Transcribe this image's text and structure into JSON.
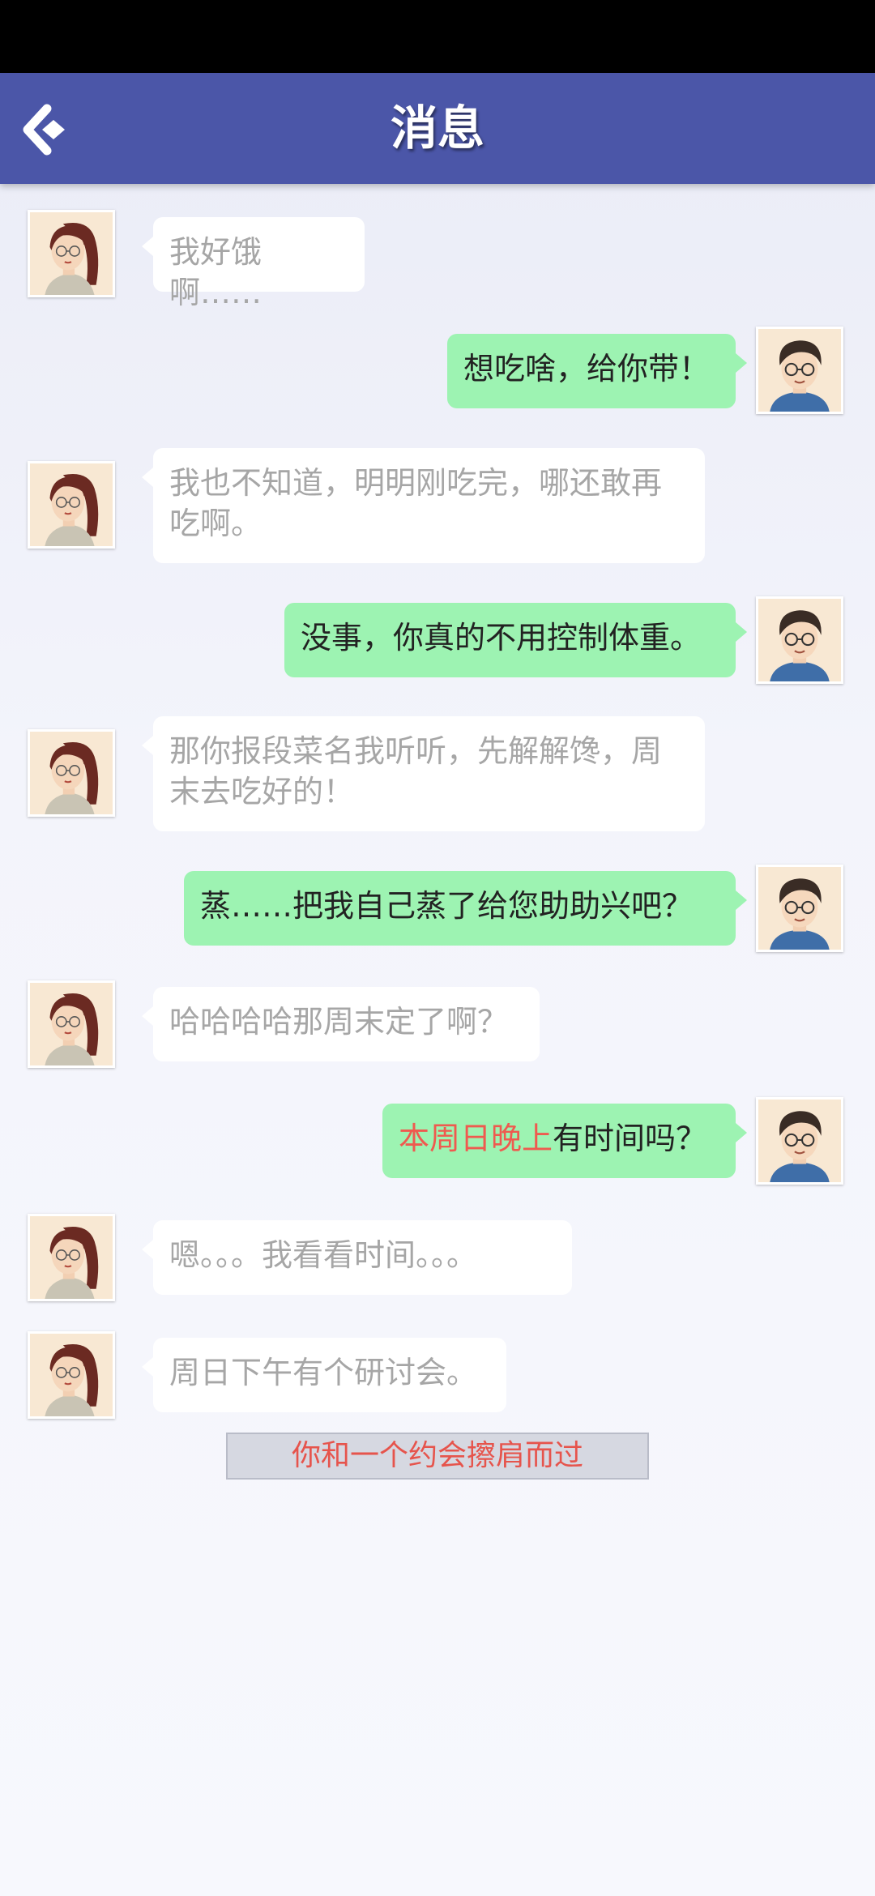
{
  "header": {
    "title": "消息",
    "back_icon": "back-arrow-icon"
  },
  "messages": [
    {
      "sender": "her",
      "text": "我好饿啊……"
    },
    {
      "sender": "me",
      "text": "想吃啥，给你带！"
    },
    {
      "sender": "her",
      "text": "我也不知道，明明刚吃完，哪还敢再吃啊。"
    },
    {
      "sender": "me",
      "text": "没事，你真的不用控制体重。"
    },
    {
      "sender": "her",
      "text": "那你报段菜名我听听，先解解馋，周末去吃好的！"
    },
    {
      "sender": "me",
      "text": "蒸……把我自己蒸了给您助助兴吧？"
    },
    {
      "sender": "her",
      "text": "哈哈哈哈那周末定了啊？"
    },
    {
      "sender": "me",
      "highlight": "本周日晚上",
      "rest": "有时间吗？"
    },
    {
      "sender": "her",
      "text": "嗯。。。我看看时间。。。"
    },
    {
      "sender": "her",
      "text": "周日下午有个研讨会。"
    }
  ],
  "notice": "你和一个约会擦肩而过",
  "colors": {
    "header": "#4b56a8",
    "my_bubble": "#9df3b2",
    "her_bubble": "#ffffff",
    "highlight": "#ef5a4f"
  }
}
